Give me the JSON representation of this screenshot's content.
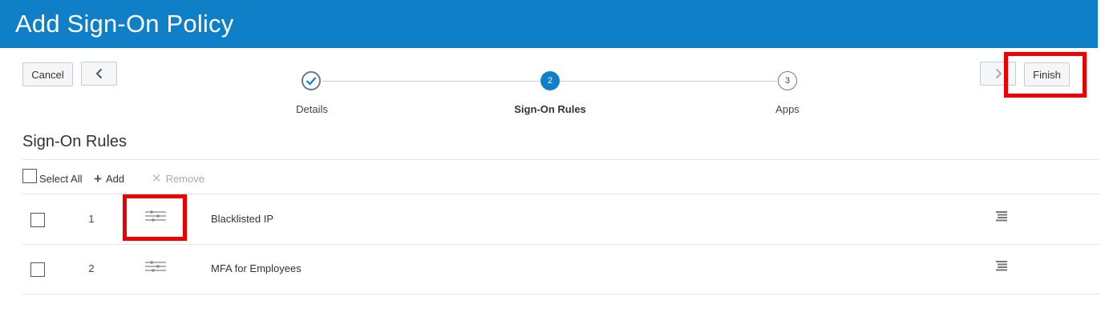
{
  "header": {
    "title": "Add Sign-On Policy",
    "background_color": "#0f7fc8"
  },
  "toolbar": {
    "cancel_label": "Cancel",
    "back_icon": "chevron-left-icon",
    "next_icon": "chevron-right-icon",
    "finish_label": "Finish"
  },
  "wizard": {
    "steps": [
      {
        "number": "",
        "label": "Details",
        "state": "completed",
        "icon": "checkmark-icon"
      },
      {
        "number": "2",
        "label": "Sign-On Rules",
        "state": "current"
      },
      {
        "number": "3",
        "label": "Apps",
        "state": "upcoming"
      }
    ]
  },
  "section": {
    "title": "Sign-On Rules"
  },
  "list_toolbar": {
    "select_all_label": "Select All",
    "add_label": "Add",
    "remove_label": "Remove"
  },
  "rules": [
    {
      "order": "1",
      "name": "Blacklisted IP"
    },
    {
      "order": "2",
      "name": "MFA for Employees"
    }
  ],
  "annotations": {
    "highlight_color": "#ee0000"
  }
}
